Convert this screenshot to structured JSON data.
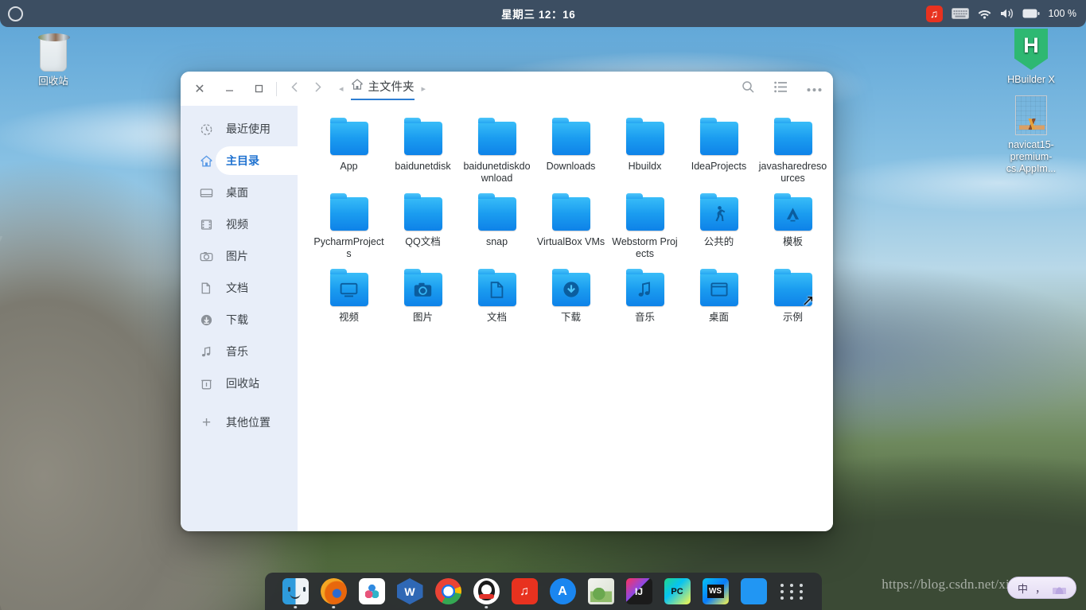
{
  "topbar": {
    "activities_label": "activities",
    "clock": "星期三 12：16",
    "tray": {
      "netease_label": "♫",
      "keyboard_icon": "keyboard-icon",
      "wifi_icon": "wifi-icon",
      "volume_icon": "volume-icon",
      "battery_icon": "battery-icon",
      "battery_percent": "100 %"
    }
  },
  "desktop": {
    "icons": [
      {
        "name": "trash",
        "label": "回收站"
      },
      {
        "name": "hbuilder",
        "label": "HBuilder X",
        "glyph": "H"
      },
      {
        "name": "navicat",
        "label": "navicat15-premium-cs.AppIm..."
      }
    ]
  },
  "window": {
    "controls": {
      "close": "✕",
      "minimize": "－",
      "maximize": "□"
    },
    "nav": {
      "back": "‹",
      "forward": "›",
      "crumb_prev": "◂",
      "crumb_next": "▸"
    },
    "breadcrumb": {
      "home_icon": "home-icon",
      "label": "主文件夹"
    },
    "toolbar": {
      "search": "search-icon",
      "list_view": "list-view-icon",
      "menu": "more-options-icon"
    },
    "sidebar": {
      "items": [
        {
          "label": "最近使用",
          "icon": "recent-clock-icon",
          "active": false
        },
        {
          "label": "主目录",
          "icon": "home-icon",
          "active": true
        },
        {
          "label": "桌面",
          "icon": "desktop-icon",
          "active": false
        },
        {
          "label": "视频",
          "icon": "film-icon",
          "active": false
        },
        {
          "label": "图片",
          "icon": "camera-icon",
          "active": false
        },
        {
          "label": "文档",
          "icon": "documents-icon",
          "active": false
        },
        {
          "label": "下载",
          "icon": "download-icon",
          "active": false
        },
        {
          "label": "音乐",
          "icon": "music-note-icon",
          "active": false
        },
        {
          "label": "回收站",
          "icon": "trash-icon",
          "active": false
        },
        {
          "label": "其他位置",
          "icon": "plus-icon",
          "active": false
        }
      ]
    },
    "files": [
      {
        "label": "App",
        "emblem": "",
        "symlink": false
      },
      {
        "label": "baidunetdisk",
        "emblem": "",
        "symlink": false
      },
      {
        "label": "baidunetdiskdownload",
        "emblem": "",
        "symlink": false
      },
      {
        "label": "Downloads",
        "emblem": "",
        "symlink": false
      },
      {
        "label": "Hbuildx",
        "emblem": "",
        "symlink": false
      },
      {
        "label": "IdeaProjects",
        "emblem": "",
        "symlink": false
      },
      {
        "label": "javasharedresources",
        "emblem": "",
        "symlink": false
      },
      {
        "label": "PycharmProjects",
        "emblem": "",
        "symlink": false
      },
      {
        "label": "QQ文档",
        "emblem": "",
        "symlink": false
      },
      {
        "label": "snap",
        "emblem": "",
        "symlink": false
      },
      {
        "label": "VirtualBox VMs",
        "emblem": "",
        "symlink": false
      },
      {
        "label": "Webstorm Projects",
        "emblem": "",
        "symlink": false
      },
      {
        "label": "公共的",
        "emblem": "🚶",
        "symlink": false
      },
      {
        "label": "模板",
        "emblem": "🅰",
        "symlink": false
      },
      {
        "label": "视频",
        "emblem": "🖵",
        "symlink": false
      },
      {
        "label": "图片",
        "emblem": "📷",
        "symlink": false
      },
      {
        "label": "文档",
        "emblem": "🗋",
        "symlink": false
      },
      {
        "label": "下载",
        "emblem": "⬇",
        "symlink": false
      },
      {
        "label": "音乐",
        "emblem": "♪",
        "symlink": false
      },
      {
        "label": "桌面",
        "emblem": "🗖",
        "symlink": false
      },
      {
        "label": "示例",
        "emblem": "",
        "symlink": true
      }
    ]
  },
  "dock": {
    "apps": [
      {
        "name": "finder",
        "label": "",
        "running": true
      },
      {
        "name": "firefox",
        "label": "",
        "running": true
      },
      {
        "name": "wps-cloud",
        "label": "",
        "running": false
      },
      {
        "name": "wps-office",
        "label": "W",
        "running": false
      },
      {
        "name": "google-chrome",
        "label": "",
        "running": false
      },
      {
        "name": "qq",
        "label": "",
        "running": true
      },
      {
        "name": "netease-music",
        "label": "♫",
        "running": false
      },
      {
        "name": "app-store",
        "label": "A",
        "running": false
      },
      {
        "name": "gimp",
        "label": "",
        "running": false
      },
      {
        "name": "intellij-idea",
        "label": "IJ",
        "running": false
      },
      {
        "name": "pycharm",
        "label": "PC",
        "running": false
      },
      {
        "name": "webstorm",
        "label": "WS",
        "running": false
      },
      {
        "name": "system-tools",
        "label": "",
        "running": false
      }
    ],
    "show_apps_label": "show-applications"
  },
  "input_method": {
    "mode": "中",
    "punct": "，",
    "lotus": "lotus-icon"
  },
  "watermark": {
    "text": "https://blog.csdn.net/xiangmaxmin"
  }
}
